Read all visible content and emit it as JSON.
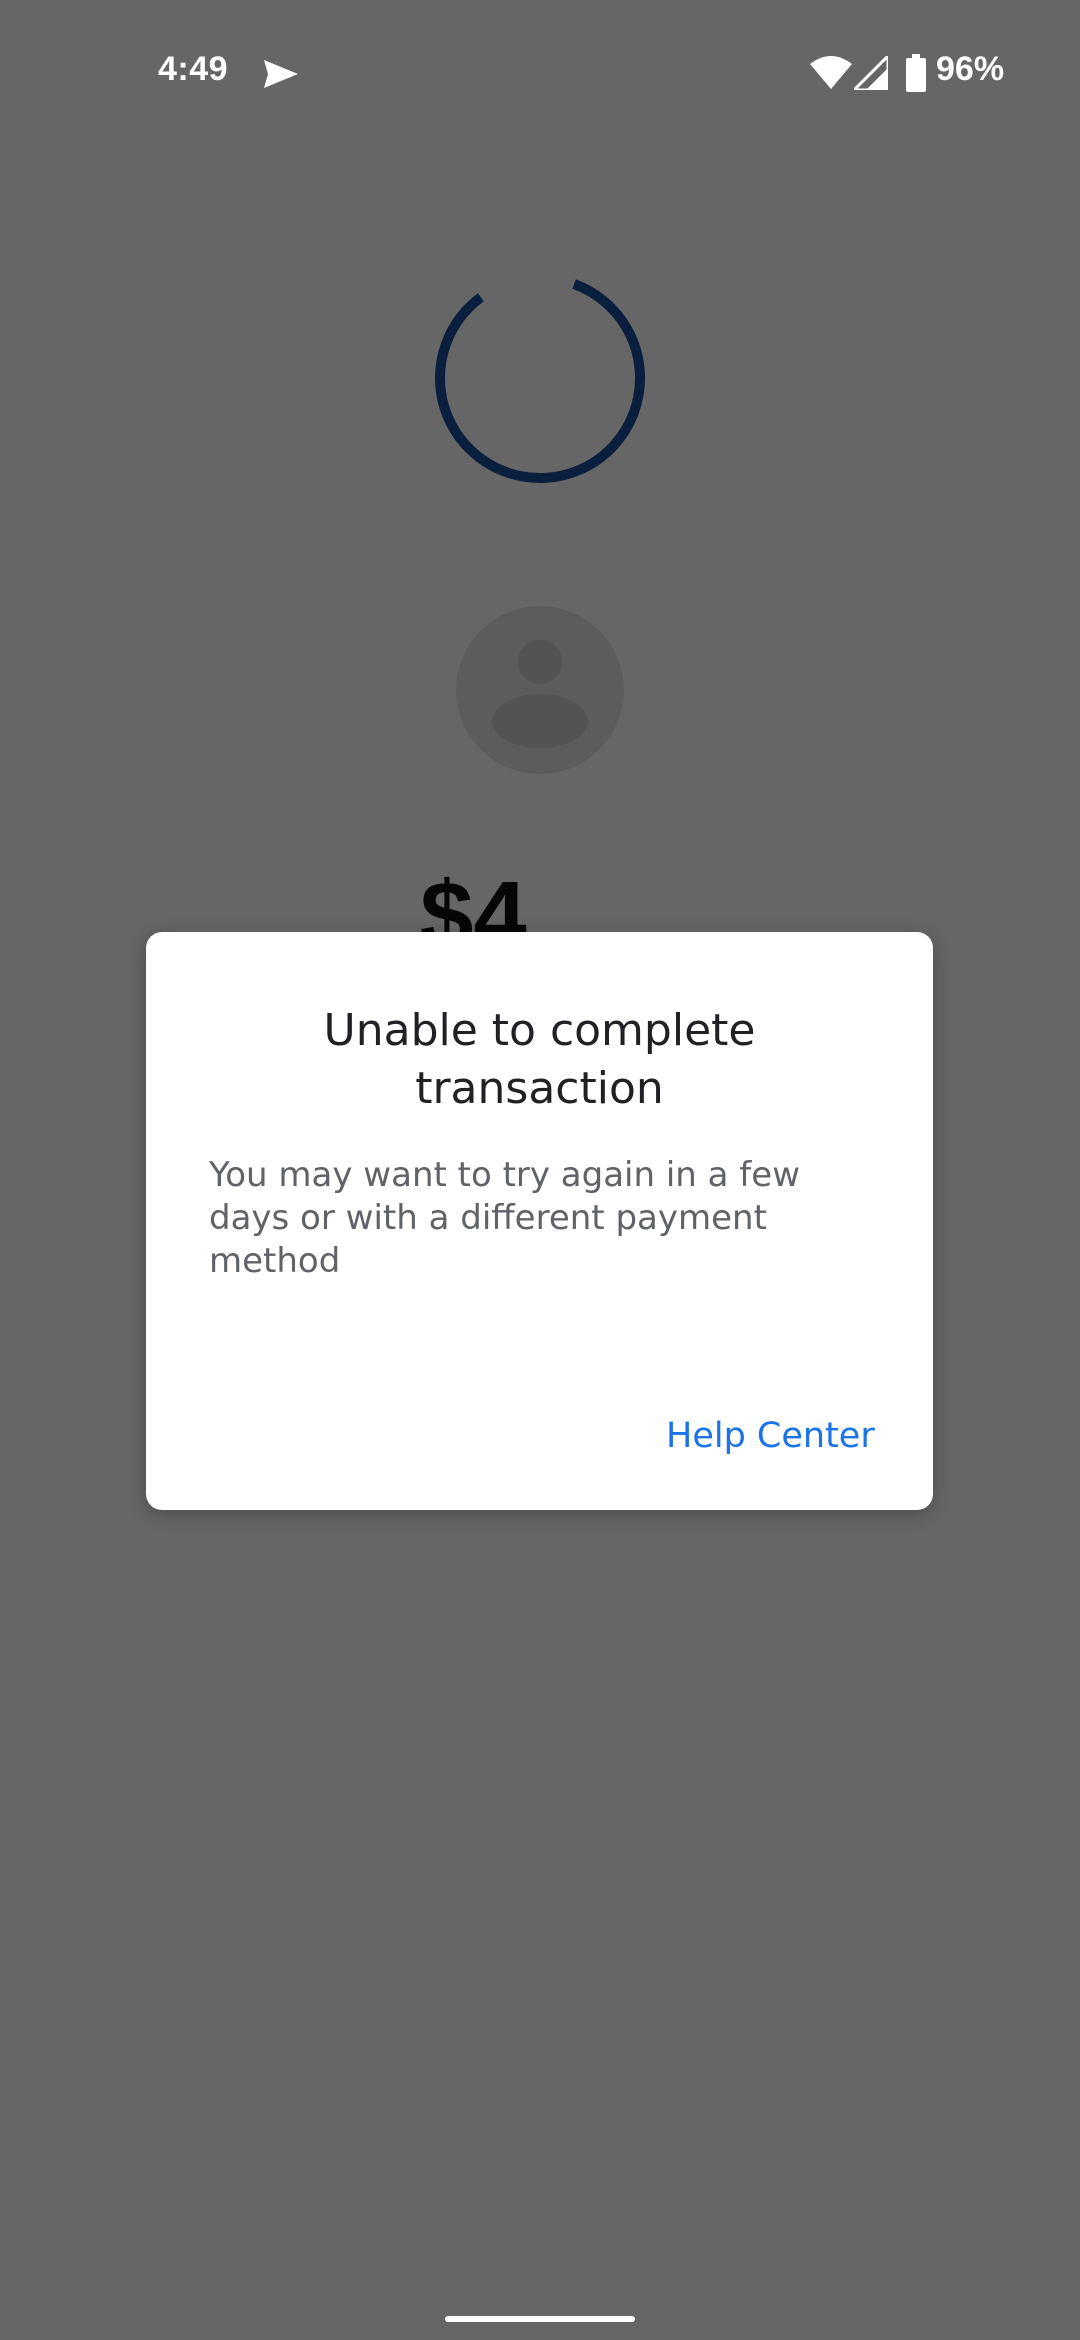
{
  "status_bar": {
    "time": "4:49",
    "battery": "96%"
  },
  "payment": {
    "amount": "$4"
  },
  "dialog": {
    "title": "Unable to complete transaction",
    "body": "You may want to try again in a few days or with a different payment method",
    "action_label": "Help Center"
  },
  "colors": {
    "accent": "#1a73e8",
    "spinner": "#1a4f9c",
    "scrim": "#666666"
  }
}
